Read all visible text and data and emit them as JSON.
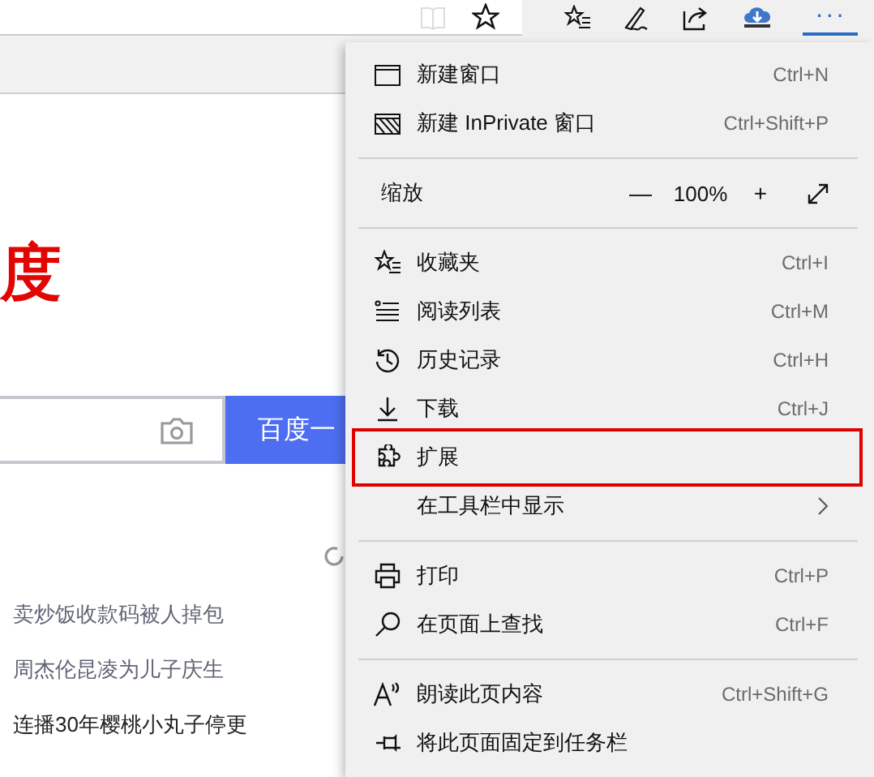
{
  "toolbar": {
    "buttons": [
      {
        "kind": "reading",
        "disabled": true
      },
      {
        "kind": "star",
        "disabled": false
      },
      {
        "kind": "favorites",
        "disabled": false
      },
      {
        "kind": "pen",
        "disabled": false
      },
      {
        "kind": "share",
        "disabled": false
      },
      {
        "kind": "download",
        "disabled": false
      },
      {
        "kind": "more",
        "label": "···",
        "selected": true
      }
    ]
  },
  "page": {
    "logo": "度",
    "search_button": "百度一",
    "news": [
      {
        "text": "卖炒饭收款码被人掉包",
        "visited": true
      },
      {
        "text": "周杰伦昆凌为儿子庆生",
        "visited": true
      },
      {
        "text": "连播30年樱桃小丸子停更",
        "visited": false
      }
    ]
  },
  "menu": {
    "items": [
      {
        "kind": "item",
        "label": "新建窗口",
        "shortcut": "Ctrl+N",
        "highlighted": false
      },
      {
        "kind": "item",
        "label": "新建 InPrivate 窗口",
        "shortcut": "Ctrl+Shift+P",
        "highlighted": false
      },
      {
        "kind": "separator"
      },
      {
        "kind": "zoom",
        "label": "缩放",
        "minus": "—",
        "value": "100%",
        "plus": "+"
      },
      {
        "kind": "separator"
      },
      {
        "kind": "item",
        "label": "收藏夹",
        "shortcut": "Ctrl+I",
        "highlighted": false
      },
      {
        "kind": "item",
        "label": "阅读列表",
        "shortcut": "Ctrl+M",
        "highlighted": false
      },
      {
        "kind": "item",
        "label": "历史记录",
        "shortcut": "Ctrl+H",
        "highlighted": false
      },
      {
        "kind": "item",
        "label": "下载",
        "shortcut": "Ctrl+J",
        "highlighted": false
      },
      {
        "kind": "item",
        "label": "扩展",
        "highlighted": true
      },
      {
        "kind": "submenu",
        "label": "在工具栏中显示",
        "highlighted": false
      },
      {
        "kind": "separator"
      },
      {
        "kind": "item",
        "label": "打印",
        "shortcut": "Ctrl+P",
        "highlighted": false
      },
      {
        "kind": "item",
        "label": "在页面上查找",
        "shortcut": "Ctrl+F",
        "highlighted": false
      },
      {
        "kind": "separator"
      },
      {
        "kind": "item",
        "label": "朗读此页内容",
        "shortcut": "Ctrl+Shift+G",
        "highlighted": false
      },
      {
        "kind": "item",
        "label": "将此页面固定到任务栏",
        "highlighted": false
      }
    ]
  }
}
